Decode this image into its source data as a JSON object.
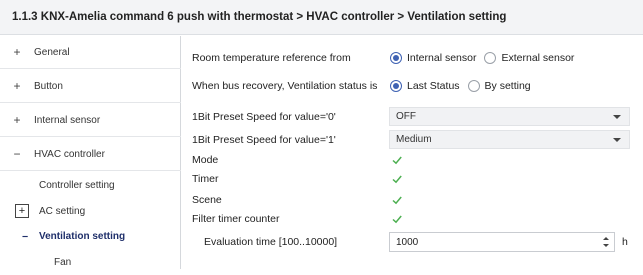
{
  "title": "1.1.3 KNX-Amelia command 6 push with thermostat > HVAC controller > Ventilation setting",
  "sidebar": {
    "items": [
      {
        "sign": "+",
        "label": "General"
      },
      {
        "sign": "+",
        "label": "Button"
      },
      {
        "sign": "+",
        "label": "Internal sensor"
      },
      {
        "sign": "−",
        "label": "HVAC controller"
      }
    ],
    "sub_items": {
      "controller_setting": "Controller setting",
      "ac_setting_sign": "+",
      "ac_setting": "AC setting",
      "ventilation_sign": "−",
      "ventilation_setting": "Ventilation setting",
      "fan": "Fan"
    }
  },
  "params": {
    "room_temp": {
      "label": "Room temperature reference from",
      "options": [
        "Internal sensor",
        "External sensor"
      ],
      "selected": "Internal sensor"
    },
    "bus_recovery": {
      "label": "When bus recovery, Ventilation status is",
      "options": [
        "Last Status",
        "By setting"
      ],
      "selected": "Last Status"
    },
    "preset0": {
      "label": "1Bit Preset Speed for value='0'",
      "value": "OFF"
    },
    "preset1": {
      "label": "1Bit Preset Speed for value='1'",
      "value": "Medium"
    },
    "mode": {
      "label": "Mode",
      "checked": true
    },
    "timer": {
      "label": "Timer",
      "checked": true
    },
    "scene": {
      "label": "Scene",
      "checked": true
    },
    "filter_timer": {
      "label": "Filter timer counter",
      "checked": true
    },
    "evaluation_time": {
      "label": "Evaluation time [100..10000]",
      "value": "1000",
      "unit": "h"
    }
  },
  "colors": {
    "accent": "#3f62b3",
    "check": "#4caf50",
    "active_nav": "#1f2f6a"
  }
}
